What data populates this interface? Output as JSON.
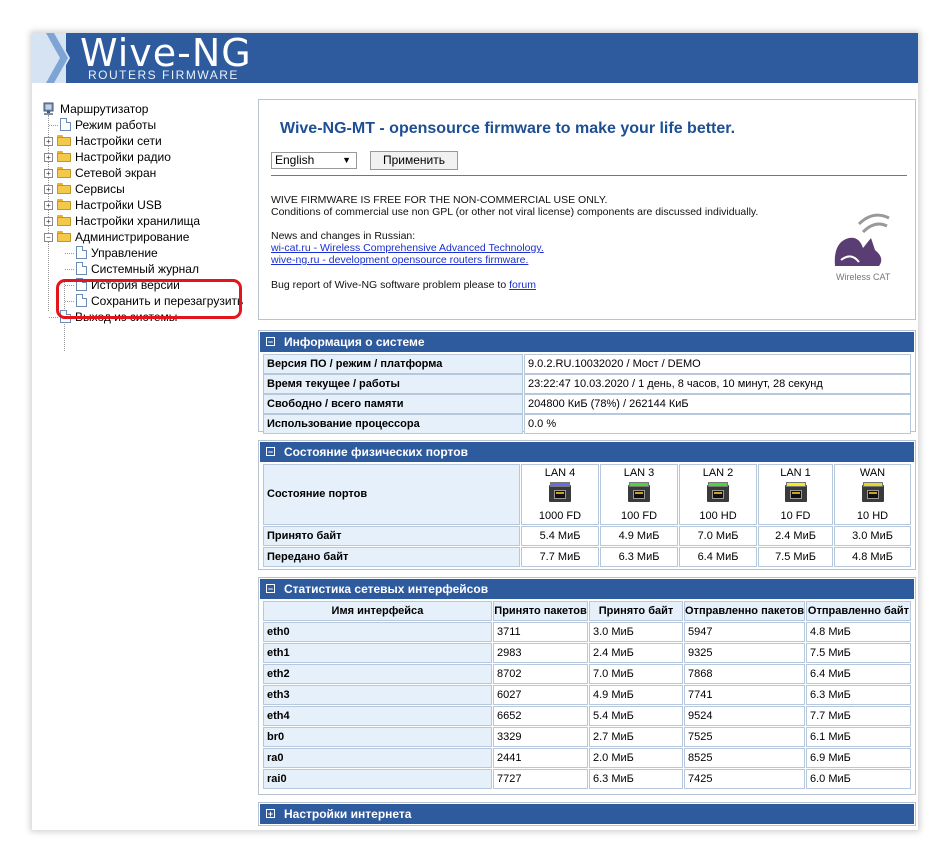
{
  "header": {
    "logo_title": "Wive-NG",
    "logo_subtitle": "ROUTERS FIRMWARE"
  },
  "sidebar": {
    "root": "Маршрутизатор",
    "items": [
      {
        "label": "Режим работы",
        "type": "page"
      },
      {
        "label": "Настройки сети",
        "type": "folder"
      },
      {
        "label": "Настройки радио",
        "type": "folder"
      },
      {
        "label": "Сетевой экран",
        "type": "folder"
      },
      {
        "label": "Сервисы",
        "type": "folder"
      },
      {
        "label": "Настройки USB",
        "type": "folder"
      },
      {
        "label": "Настройки хранилища",
        "type": "folder"
      },
      {
        "label": "Администрирование",
        "type": "folder",
        "expanded": true,
        "children": [
          "Управление",
          "Системный журнал",
          "История версий",
          "Сохранить и перезагрузить"
        ]
      },
      {
        "label": "Выход из системы",
        "type": "page"
      }
    ],
    "highlighted_item": "Сохранить и перезагрузить"
  },
  "intro": {
    "title": "Wive-NG-MT - opensource firmware to make your life better.",
    "language_value": "English",
    "apply_label": "Применить",
    "line1": "WIVE FIRMWARE IS FREE FOR THE NON-COMMERCIAL USE ONLY.",
    "line2": "Conditions of commercial use non GPL (or other not viral license) components are discussed individually.",
    "news_label": "News and changes in Russian:",
    "link1": "wi-cat.ru - Wireless Comprehensive Advanced Technology.",
    "link2": "wive-ng.ru - development opensource routers firmware.",
    "bug_text": "Bug report of Wive-NG software problem please to",
    "forum_link": "forum",
    "cat_caption": "Wireless CAT"
  },
  "sysinfo": {
    "title": "Информация о системе",
    "rows": [
      {
        "label": "Версия ПО / режим / платформа",
        "value": "9.0.2.RU.10032020 / Мост / DEMO"
      },
      {
        "label": "Время текущее / работы",
        "value": "23:22:47 10.03.2020 / 1 день, 8 часов, 10 минут, 28 секунд"
      },
      {
        "label": "Свободно / всего памяти",
        "value": "204800 КиБ (78%) / 262144 КиБ"
      },
      {
        "label": "Использование процессора",
        "value": "0.0 %"
      }
    ]
  },
  "ports": {
    "title": "Состояние физических портов",
    "state_label": "Состояние портов",
    "rx_label": "Принято байт",
    "tx_label": "Передано байт",
    "list": [
      {
        "name": "LAN 4",
        "speed": "1000 FD",
        "led": "#6a6ae8",
        "rx": "5.4 МиБ",
        "tx": "7.7 МиБ"
      },
      {
        "name": "LAN 3",
        "speed": "100 FD",
        "led": "#4bd63a",
        "rx": "4.9 МиБ",
        "tx": "6.3 МиБ"
      },
      {
        "name": "LAN 2",
        "speed": "100 HD",
        "led": "#4bd63a",
        "rx": "7.0 МиБ",
        "tx": "6.4 МиБ"
      },
      {
        "name": "LAN 1",
        "speed": "10 FD",
        "led": "#f2ea2a",
        "rx": "2.4 МиБ",
        "tx": "7.5 МиБ"
      },
      {
        "name": "WAN",
        "speed": "10 HD",
        "led": "#e2d82a",
        "rx": "3.0 МиБ",
        "tx": "4.8 МиБ"
      }
    ]
  },
  "netstats": {
    "title": "Статистика сетевых интерфейсов",
    "columns": [
      "Имя интерфейса",
      "Принято пакетов",
      "Принято байт",
      "Отправленно пакетов",
      "Отправленно байт"
    ],
    "rows": [
      [
        "eth0",
        "3711",
        "3.0 МиБ",
        "5947",
        "4.8 МиБ"
      ],
      [
        "eth1",
        "2983",
        "2.4 МиБ",
        "9325",
        "7.5 МиБ"
      ],
      [
        "eth2",
        "8702",
        "7.0 МиБ",
        "7868",
        "6.4 МиБ"
      ],
      [
        "eth3",
        "6027",
        "4.9 МиБ",
        "7741",
        "6.3 МиБ"
      ],
      [
        "eth4",
        "6652",
        "5.4 МиБ",
        "9524",
        "7.7 МиБ"
      ],
      [
        "br0",
        "3329",
        "2.7 МиБ",
        "7525",
        "6.1 МиБ"
      ],
      [
        "ra0",
        "2441",
        "2.0 МиБ",
        "8525",
        "6.9 МиБ"
      ],
      [
        "rai0",
        "7727",
        "6.3 МиБ",
        "7425",
        "6.0 МиБ"
      ]
    ]
  },
  "internet": {
    "title": "Настройки интернета"
  },
  "colors": {
    "header_blue": "#2e5a9e",
    "title_blue": "#1e4f93",
    "highlight_red": "#e2141c",
    "label_bg": "#e6f0fa"
  }
}
